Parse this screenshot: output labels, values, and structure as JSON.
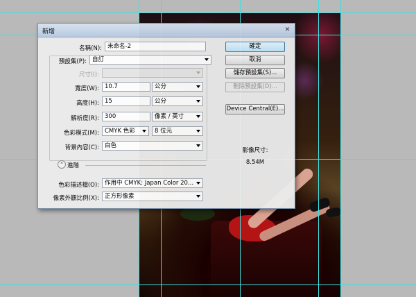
{
  "dialog": {
    "title": "新增",
    "close": "✕"
  },
  "fields": {
    "name_label": "名稱(N):",
    "name_value": "未命名-2",
    "preset_label": "預設集(P):",
    "preset_value": "自訂",
    "size_label": "尺寸(I):",
    "width_label": "寬度(W):",
    "width_value": "10.7",
    "width_unit": "公分",
    "height_label": "高度(H):",
    "height_value": "15",
    "height_unit": "公分",
    "resolution_label": "解析度(R):",
    "resolution_value": "300",
    "resolution_unit": "像素 / 英寸",
    "colormode_label": "色彩模式(M):",
    "colormode_value": "CMYK 色彩",
    "bitdepth_value": "8 位元",
    "background_label": "背景內容(C):",
    "background_value": "白色",
    "advanced_label": "進階",
    "profile_label": "色彩描述檔(O):",
    "profile_value": "作用中 CMYK:  Japan Color 20...",
    "aspect_label": "像素外觀比例(X):",
    "aspect_value": "正方形像素"
  },
  "buttons": {
    "ok": "確定",
    "cancel": "取消",
    "save_preset": "儲存預設集(S)...",
    "delete_preset": "刪除預設集(D)...",
    "device_central": "Device Central(E)..."
  },
  "image_size": {
    "label": "影像尺寸:",
    "value": "8.54M"
  }
}
